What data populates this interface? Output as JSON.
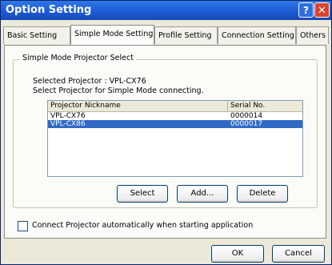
{
  "window": {
    "title": "Option Setting"
  },
  "tabs": [
    "Basic Setting",
    "Simple Mode Setting",
    "Profile Setting",
    "Connection Setting",
    "Others"
  ],
  "group": {
    "legend": "Simple Mode Projector Select",
    "selected_text": "Selected Projector : VPL-CX76",
    "instruction": "Select Projector for Simple Mode connecting."
  },
  "list": {
    "columns": [
      "Projector Nickname",
      "Serial No."
    ],
    "rows": [
      {
        "nickname": "VPL-CX76",
        "serial": "0000014"
      },
      {
        "nickname": "VPL-CX86",
        "serial": "0000017",
        "selected": true
      }
    ]
  },
  "buttons": {
    "select": "Select",
    "add": "Add...",
    "delete": "Delete",
    "ok": "OK",
    "cancel": "Cancel"
  },
  "checkbox": {
    "label": "Connect Projector automatically when starting application",
    "checked": false
  },
  "colors": {
    "title_bar": "#1c5ad6",
    "selection": "#316ac5",
    "close_button": "#d9432a"
  }
}
